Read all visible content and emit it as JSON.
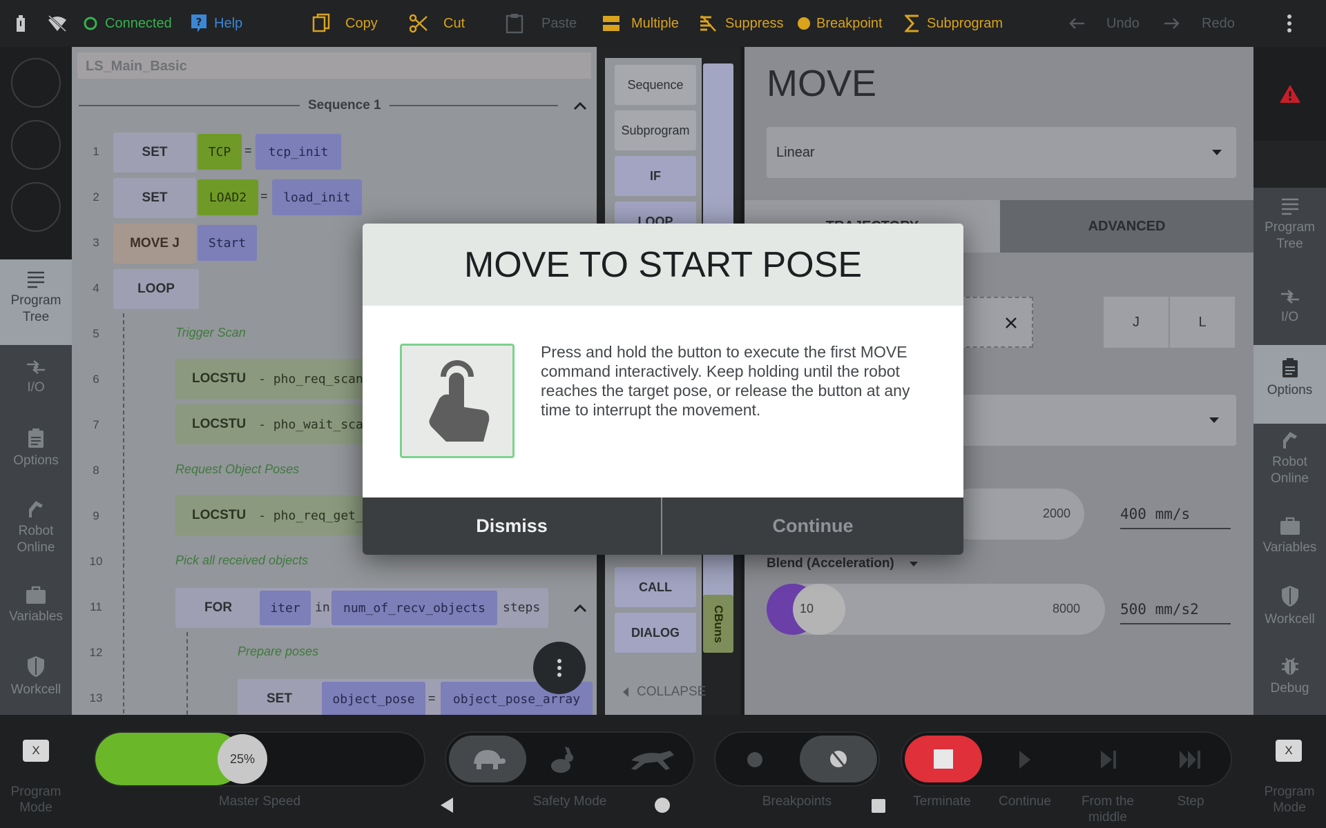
{
  "topbar": {
    "connected": "Connected",
    "help": "Help",
    "copy": "Copy",
    "cut": "Cut",
    "paste": "Paste",
    "multiple": "Multiple",
    "suppress": "Suppress",
    "breakpoint": "Breakpoint",
    "subprogram": "Subprogram",
    "undo": "Undo",
    "redo": "Redo"
  },
  "left_nav": {
    "program_tree": [
      "Program",
      "Tree"
    ],
    "io": "I/O",
    "options": "Options",
    "robot_online": [
      "Robot",
      "Online"
    ],
    "variables": "Variables",
    "workcell": "Workcell"
  },
  "right_nav": {
    "program_tree": [
      "Program",
      "Tree"
    ],
    "io": "I/O",
    "options": "Options",
    "robot_online": [
      "Robot",
      "Online"
    ],
    "variables": "Variables",
    "workcell": "Workcell",
    "debug": "Debug"
  },
  "tree": {
    "program_name": "LS_Main_Basic",
    "sequence": "Sequence 1",
    "lines": {
      "1": {
        "cmd": "SET",
        "a": "TCP",
        "eq": "=",
        "b": "tcp_init"
      },
      "2": {
        "cmd": "SET",
        "a": "LOAD2",
        "eq": "=",
        "b": "load_init"
      },
      "3": {
        "cmd": "MOVE J",
        "a": "Start"
      },
      "4": {
        "cmd": "LOOP"
      },
      "5": {
        "comment": "Trigger Scan"
      },
      "6": {
        "cmd": "LOCSTU",
        "arg": "- pho_req_scan"
      },
      "7": {
        "cmd": "LOCSTU",
        "arg": "- pho_wait_sca"
      },
      "8": {
        "comment": "Request Object Poses"
      },
      "9": {
        "cmd": "LOCSTU",
        "arg": "- pho_req_get_"
      },
      "10": {
        "comment": "Pick all received objects"
      },
      "11": {
        "cmd": "FOR",
        "a": "iter",
        "in": "in",
        "b": "num_of_recv_objects",
        "steps": "steps"
      },
      "12": {
        "comment": "Prepare poses"
      },
      "13": {
        "cmd": "SET",
        "a": "object_pose",
        "eq": "=",
        "b": "object_pose_array",
        "tail": "["
      }
    }
  },
  "palette": {
    "sequence": "Sequence",
    "subprogram": "Subprogram",
    "if": "IF",
    "loop": "LOOP",
    "call": "CALL",
    "dialog": "DIALOG",
    "cbuns": "CBuns",
    "collapse": "COLLAPSE"
  },
  "props": {
    "title": "MOVE",
    "move_type": "Linear",
    "tab_trajectory": "TRAJECTORY",
    "tab_advanced": "ADVANCED",
    "j_label": "J",
    "l_label": "L",
    "speed_max": "2000",
    "speed_value": "400 mm/s",
    "blend_label": "Blend (Acceleration)",
    "accel_min": "10",
    "accel_max": "8000",
    "accel_value": "500 mm/s2"
  },
  "modal": {
    "title": "MOVE TO START POSE",
    "body": "Press and hold the button to execute the first MOVE command interactively. Keep holding until the robot reaches the target pose, or release the button at any time to interrupt the movement.",
    "dismiss": "Dismiss",
    "continue": "Continue"
  },
  "bottombar": {
    "program_mode": [
      "Program",
      "Mode"
    ],
    "x": "X",
    "master_speed_value": "25%",
    "master_speed_fraction": 0.25,
    "master_speed": "Master Speed",
    "safety_mode": "Safety Mode",
    "breakpoints": "Breakpoints",
    "terminate": "Terminate",
    "continue": "Continue",
    "from_middle": [
      "From the",
      "middle"
    ],
    "step": "Step"
  },
  "colors": {
    "connected": "#37b24d",
    "help": "#3b87d6",
    "accent": "#d9a31c",
    "terminate": "#e0303a",
    "speed": "#6ab82a",
    "accel": "#6a3fa8"
  }
}
